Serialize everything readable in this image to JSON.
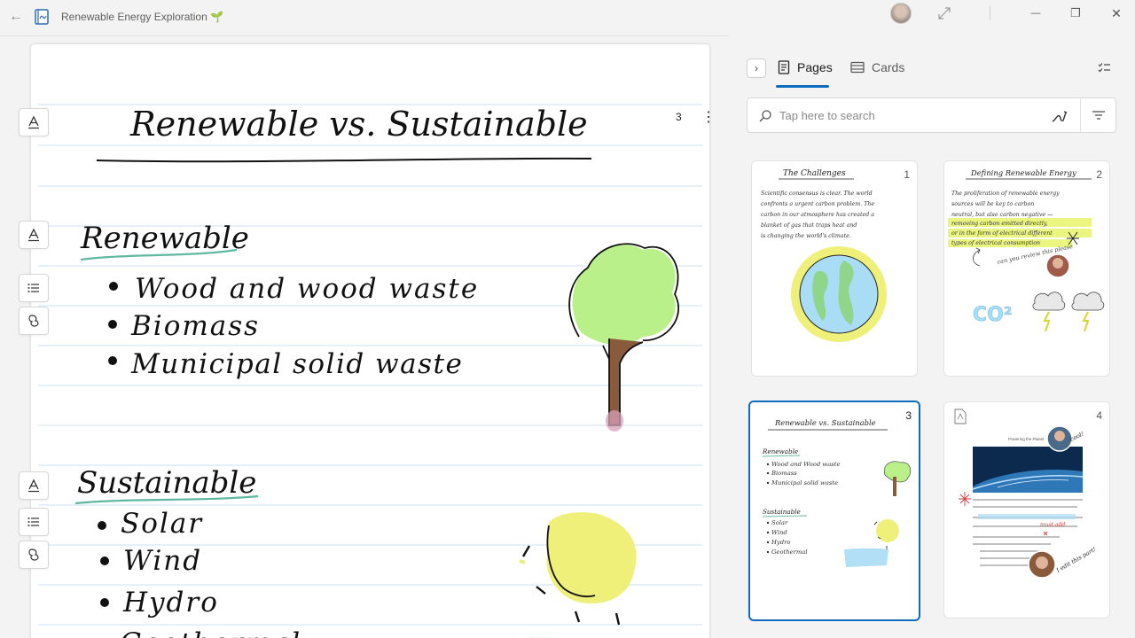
{
  "window": {
    "title": "Renewable Energy Exploration",
    "title_emoji": "🌱",
    "back_label": "←",
    "controls": {
      "minimize": "—",
      "maximize": "❐",
      "close": "✕"
    }
  },
  "canvas": {
    "page_number": "3",
    "more_label": "⋮",
    "title": "Renewable vs. Sustainable",
    "sections": [
      {
        "heading": "Renewable",
        "items": [
          "Wood and wood waste",
          "Biomass",
          "Municipal solid waste"
        ]
      },
      {
        "heading": "Sustainable",
        "items": [
          "Solar",
          "Wind",
          "Hydro",
          "Geothermal"
        ]
      }
    ]
  },
  "panel": {
    "collapse_label": "›",
    "tabs": [
      {
        "label": "Pages",
        "icon": "pages-icon",
        "active": true
      },
      {
        "label": "Cards",
        "icon": "cards-icon",
        "active": false
      }
    ],
    "search": {
      "placeholder": "Tap here to search"
    },
    "thumbnails": [
      {
        "number": "1",
        "title": "The Challenges",
        "lines": [
          "Scientific consensus is clear. The world",
          "confronts a urgent carbon problem. The",
          "carbon in our atmosphere has created a",
          "blanket of gas that traps heat and",
          "is changing the world's climate."
        ]
      },
      {
        "number": "2",
        "title": "Defining Renewable Energy",
        "lines": [
          "The proliferation of renewable energy",
          "sources will be key to carbon",
          "neutral, but also carbon negative —",
          "removing carbon emitted directly,",
          "or in the form of electrical different",
          "types of electrical consumption"
        ],
        "note": "can you review this please",
        "co2": "CO²"
      },
      {
        "number": "3",
        "title": "Renewable vs. Sustainable",
        "sub1": "Renewable",
        "items1": [
          "Wood and Wood waste",
          "Biomass",
          "Municipal solid waste"
        ],
        "sub2": "Sustainable",
        "items2": [
          "Solar",
          "Wind",
          "Hydro",
          "Geothermal"
        ]
      },
      {
        "number": "4",
        "heading": "Powering the Planet",
        "note1": "cool!",
        "note2": "must add",
        "note3": "I edit this part!"
      }
    ]
  },
  "colors": {
    "accent": "#0f6cbd",
    "rule_line": "#d6e6f3",
    "underline_green": "#5fb8a0",
    "tree_green": "#b9f08a",
    "sun_yellow": "#eef07a",
    "sky_blue": "#a9dcf5",
    "highlighter": "#e6f56a"
  }
}
